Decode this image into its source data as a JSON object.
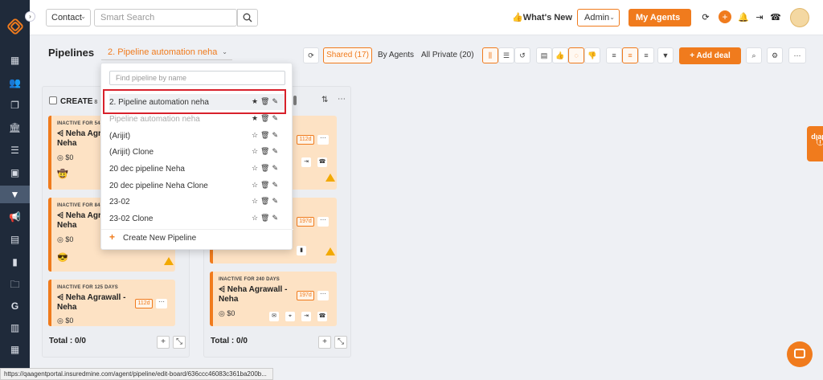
{
  "sidebar": {
    "icons": [
      "dashboard-icon",
      "contacts-icon",
      "documents-icon",
      "bank-icon",
      "list-icon",
      "id-card-icon",
      "pipeline-filter-icon",
      "megaphone-icon",
      "book-icon",
      "chart-icon",
      "folder-icon",
      "google-icon",
      "report-icon",
      "calendar-icon"
    ],
    "active_index": 6
  },
  "topbar": {
    "contact_select": "Contact",
    "search_placeholder": "Smart Search",
    "whats_new": "👍What's New",
    "admin_select": "Admin",
    "my_agents": "My Agents"
  },
  "pipelines": {
    "title": "Pipelines",
    "selected": "2. Pipeline automation neha",
    "shared": "Shared (17)",
    "by_agents": "By Agents",
    "all_private": "All Private (20)",
    "add_deal": "Add deal"
  },
  "dropdown": {
    "search_placeholder": "Find pipeline by name",
    "items": [
      {
        "label": "2. Pipeline automation neha",
        "starred": true,
        "selected": true
      },
      {
        "label": "Pipeline automation neha",
        "starred": true,
        "greyed": true
      },
      {
        "label": "(Arijit)",
        "starred": false
      },
      {
        "label": "(Arijit) Clone",
        "starred": false
      },
      {
        "label": "20 dec pipeline Neha",
        "starred": false
      },
      {
        "label": "20 dec pipeline Neha Clone",
        "starred": false
      },
      {
        "label": "23-02",
        "starred": false
      },
      {
        "label": "23-02 Clone",
        "starred": false
      }
    ],
    "create_label": "Create New Pipeline"
  },
  "columns": [
    {
      "header": "CREATE",
      "count": "8",
      "total": "Total : 0/0",
      "cards": [
        {
          "tag": "INACTIVE FOR 54",
          "name": "Neha Agra",
          "name2": "Neha",
          "amount": "$0"
        },
        {
          "tag": "INACTIVE FOR 84",
          "name": "Neha Agra",
          "name2": "Neha",
          "amount": "$0"
        },
        {
          "tag": "INACTIVE FOR 125 DAYS",
          "name": "Neha Agrawall -",
          "name2": "Neha",
          "amount": "$0",
          "days": "112d"
        }
      ]
    },
    {
      "header": "",
      "count": "",
      "total": "Total : 0/0",
      "cards": [
        {
          "tag": "",
          "name": "",
          "name2": "",
          "amount": "",
          "days": "112d"
        },
        {
          "tag": "",
          "name": "",
          "name2": "",
          "amount": "",
          "days": "197d"
        },
        {
          "tag": "INACTIVE FOR 240 DAYS",
          "name": "Neha Agrawall -",
          "name2": "Neha",
          "amount": "$0",
          "days": "197d"
        }
      ]
    }
  ],
  "help": "Help",
  "statusbar": "https://qaagentportal.insuredmine.com/agent/pipeline/edit-board/636ccc46083c361ba200b..."
}
